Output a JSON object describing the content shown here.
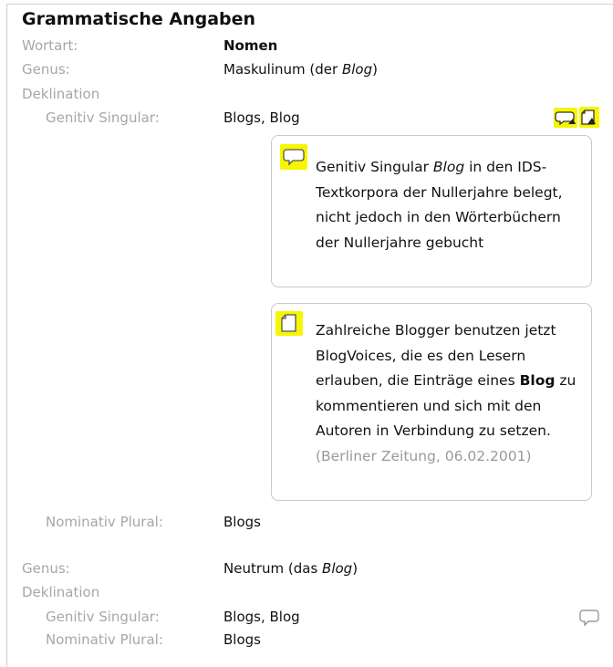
{
  "section_title": "Grammatische Angaben",
  "wortart": {
    "label": "Wortart:",
    "value": "Nomen"
  },
  "entry1": {
    "genus_label": "Genus:",
    "genus_pre": "Maskulinum (der ",
    "genus_italic": "Blog",
    "genus_post": ")",
    "deklination_label": "Deklination",
    "gen_sg_label": "Genitiv Singular:",
    "gen_sg_value": "Blogs, Blog",
    "nom_pl_label": "Nominativ Plural:",
    "nom_pl_value": "Blogs"
  },
  "comment_card": {
    "part1": "Genitiv Singular ",
    "italic": "Blog",
    "part2": " in den IDS-Textkorpora der Nullerjahre belegt, nicht jedoch in den Wörterbüchern der Nullerjahre gebucht"
  },
  "citation_card": {
    "part1": "Zahlreiche Blogger benutzen jetzt BlogVoices, die es den Lesern erlauben, die Einträge eines ",
    "bold": "Blog",
    "part2": " zu kommentieren und sich mit den Autoren in Verbindung zu setzen.",
    "source": " (Berliner Zeitung, 06.02.2001)"
  },
  "entry2": {
    "genus_label": "Genus:",
    "genus_pre": "Neutrum (das ",
    "genus_italic": "Blog",
    "genus_post": ")",
    "deklination_label": "Deklination",
    "gen_sg_label": "Genitiv Singular:",
    "gen_sg_value": "Blogs, Blog",
    "nom_pl_label": "Nominativ Plural:",
    "nom_pl_value": "Blogs"
  },
  "colors": {
    "highlight": "#f6f600",
    "label_grey": "#a7a7a7",
    "border": "#c9c9c9"
  },
  "icons": [
    "speech-bubble-icon",
    "document-icon"
  ]
}
